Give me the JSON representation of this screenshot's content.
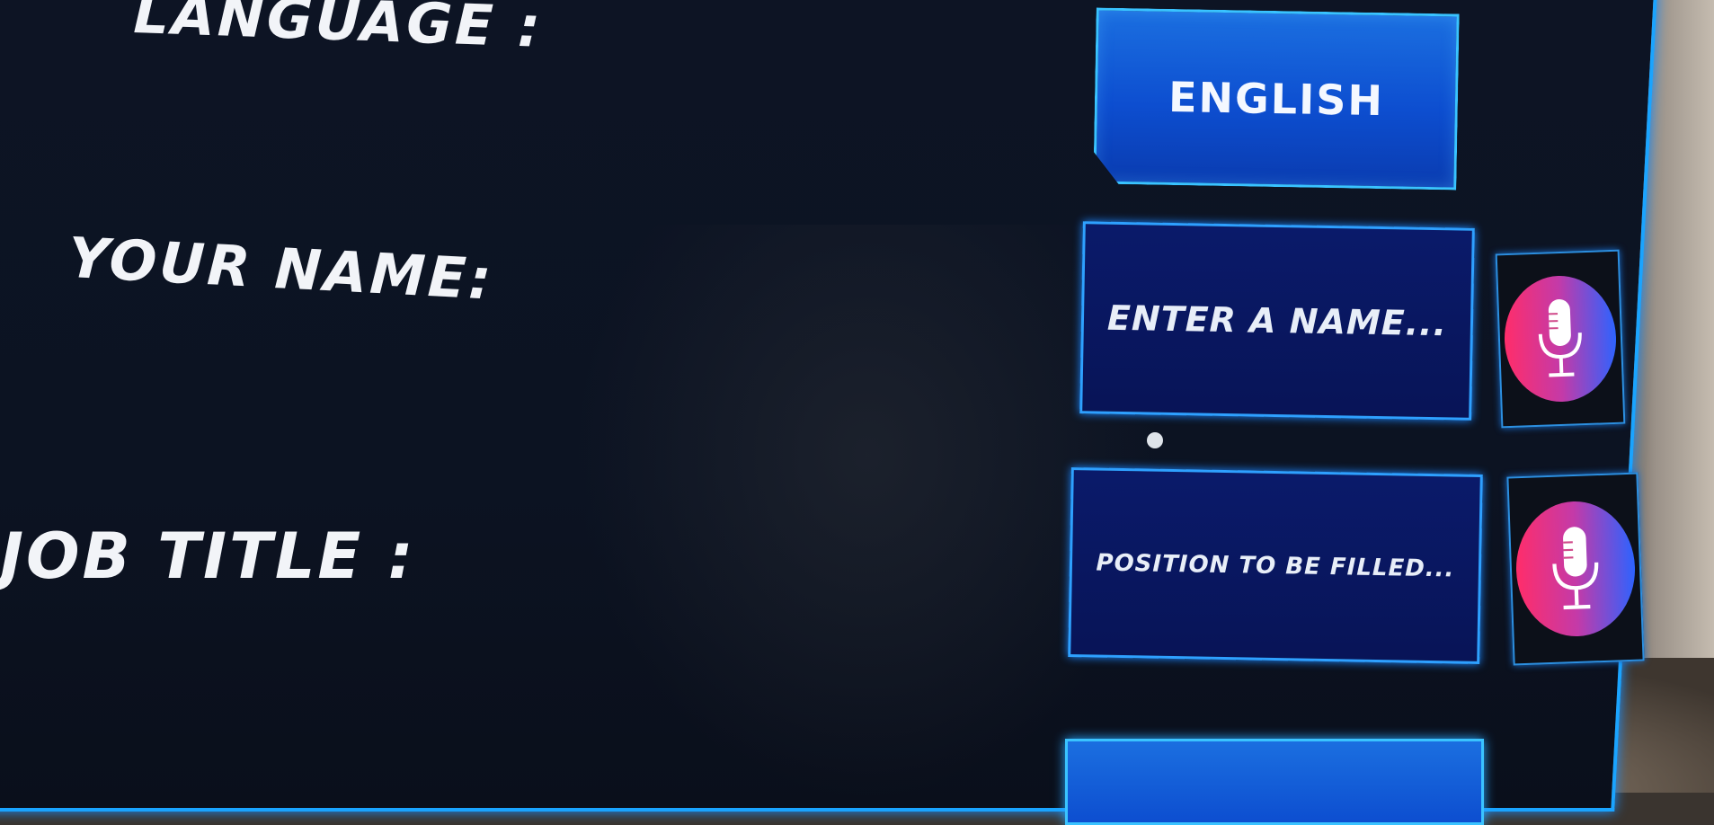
{
  "labels": {
    "language": "LANGUAGE :",
    "your_name": "YOUR NAME:",
    "job_title": "JOB TITLE :"
  },
  "language_button": {
    "label": "ENGLISH"
  },
  "name_field": {
    "placeholder": "ENTER A NAME..."
  },
  "job_field": {
    "placeholder": "POSITION TO BE FILLED..."
  },
  "icons": {
    "mic": "microphone-icon"
  },
  "colors": {
    "accent": "#1aa4ff",
    "button_fill": "#0d4ed0",
    "field_fill": "#081457",
    "panel_bg": "#0c1322",
    "mic_gradient_start": "#ff2d6a",
    "mic_gradient_end": "#2d63ff"
  }
}
